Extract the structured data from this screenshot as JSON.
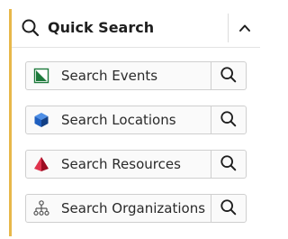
{
  "header": {
    "title": "Quick Search",
    "search_icon": "search-icon",
    "collapse_icon": "chevron-up-icon"
  },
  "items": [
    {
      "label": "Search Events",
      "icon": "events-icon",
      "icon_color": "#1e7a3c"
    },
    {
      "label": "Search Locations",
      "icon": "locations-cube-icon",
      "icon_color": "#1f5fbf"
    },
    {
      "label": "Search Resources",
      "icon": "resources-pyramid-icon",
      "icon_color": "#c8102e"
    },
    {
      "label": "Search Organizations",
      "icon": "organizations-hierarchy-icon",
      "icon_color": "#555555"
    }
  ],
  "colors": {
    "accent_border": "#e8b84a"
  }
}
